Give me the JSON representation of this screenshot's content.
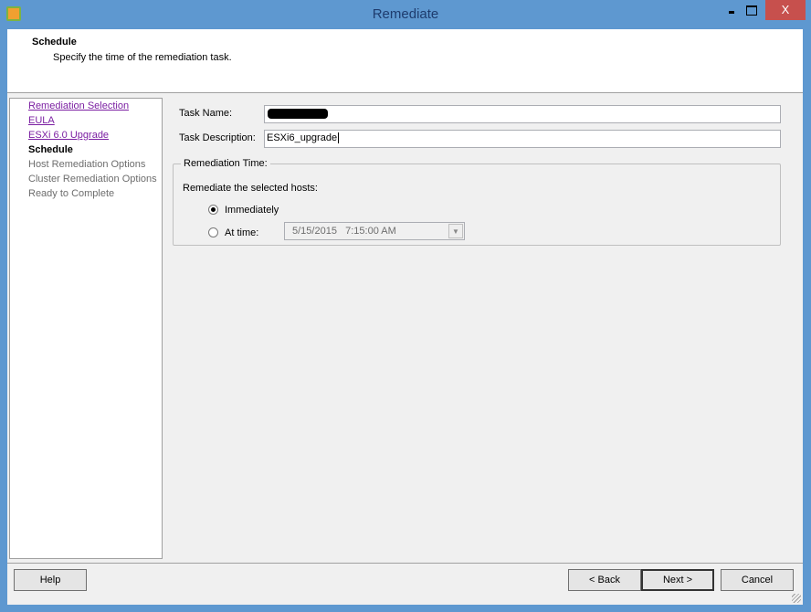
{
  "window": {
    "title": "Remediate",
    "close_glyph": "X"
  },
  "header": {
    "title": "Schedule",
    "subtitle": "Specify the time of the remediation task."
  },
  "nav": {
    "items": [
      {
        "label": "Remediation Selection",
        "state": "link"
      },
      {
        "label": "EULA",
        "state": "link"
      },
      {
        "label": "ESXi 6.0 Upgrade",
        "state": "link"
      },
      {
        "label": "Schedule",
        "state": "current"
      },
      {
        "label": "Host Remediation Options",
        "state": "disabled"
      },
      {
        "label": "Cluster Remediation Options",
        "state": "disabled"
      },
      {
        "label": "Ready to Complete",
        "state": "disabled"
      }
    ]
  },
  "form": {
    "task_name_label": "Task Name:",
    "task_name_value": "",
    "task_description_label": "Task Description:",
    "task_description_value": "ESXi6_upgrade",
    "group_label": "Remediation Time:",
    "prompt": "Remediate the selected hosts:",
    "option_immediately": "Immediately",
    "option_at_time": "At time:",
    "datetime_value": "5/15/2015   7:15:00 AM",
    "selected": "Immediately"
  },
  "buttons": {
    "help": "Help",
    "back": "< Back",
    "next": "Next >",
    "cancel": "Cancel"
  }
}
